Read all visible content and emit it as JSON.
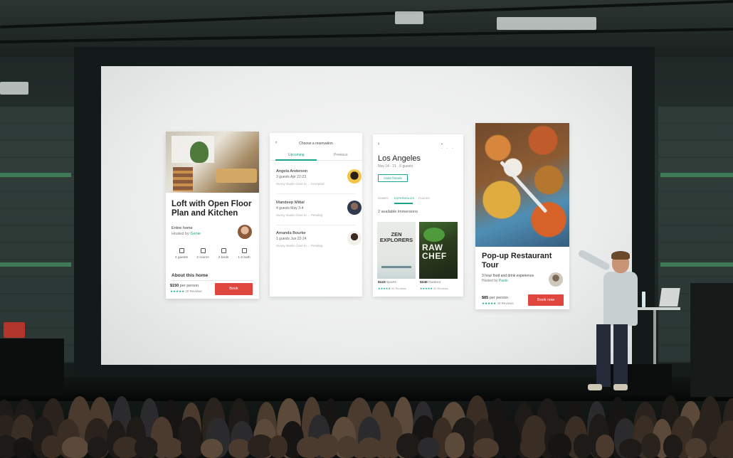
{
  "slide": {
    "phone_loft": {
      "title": "Loft with Open Floor Plan and Kitchen",
      "listing_type": "Entire home",
      "hosted_by_prefix": "Hosted by ",
      "host_name": "Genie",
      "amenities": [
        {
          "icon": "guests-icon",
          "label": "4 guests"
        },
        {
          "icon": "rooms-icon",
          "label": "2 rooms"
        },
        {
          "icon": "beds-icon",
          "label": "2 beds"
        },
        {
          "icon": "bath-icon",
          "label": "1.5 bath"
        }
      ],
      "about_heading": "About this home",
      "price": "$150",
      "price_unit": " per person",
      "rating": "★★★★★",
      "reviews": " 40 Reviews",
      "book_label": "Book"
    },
    "phone_reservations": {
      "back": "‹",
      "header": "Choose a reservation",
      "tabs": [
        "Upcoming",
        "Previous"
      ],
      "reservations": [
        {
          "name": "Angela Anderson",
          "details": "3 guests   Apr 22-23",
          "message": "Sunny studio close to ...   Accepted"
        },
        {
          "name": "Mandeep Mittal",
          "details": "4 guests   May 3-4",
          "message": "Sunny studio close to ...   Pending"
        },
        {
          "name": "Amanda Bourke",
          "details": "1 guests   Jun 22-24",
          "message": "Sunny studio close to ...   Pending"
        }
      ]
    },
    "phone_city": {
      "back": "‹",
      "top_icons": "▪ ···",
      "city": "Los Angeles",
      "dates": "Nov 14 - 21 · 6 guests",
      "invite_label": "Invite friends",
      "tabs": [
        "HOMES",
        "EXPERIENCES",
        "PLACES"
      ],
      "available": "2 available immersions",
      "cards": [
        {
          "art_text": "ZEN EXPLORERS",
          "price": "$123",
          "category": " Sports",
          "rating": "★★★★★",
          "reviews": " 40 Reviews"
        },
        {
          "art_text": "RAW CHEF",
          "price": "$240",
          "category": " Outdoor",
          "rating": "★★★★★",
          "reviews": " 40 Reviews"
        }
      ]
    },
    "phone_tour": {
      "title": "Pop-up Restaurant Tour",
      "description": "3 hour food and drink experience",
      "hosted_by_prefix": "Hosted by ",
      "host_name": "Paolo",
      "price": "$85",
      "price_unit": " per person",
      "rating": "★★★★★",
      "reviews": " 40 Reviews",
      "book_label": "Book now"
    }
  },
  "colors": {
    "accent_teal": "#19a38b",
    "book_red": "#e0463e",
    "screen": "#eceeed",
    "hall": "#1b2422"
  }
}
